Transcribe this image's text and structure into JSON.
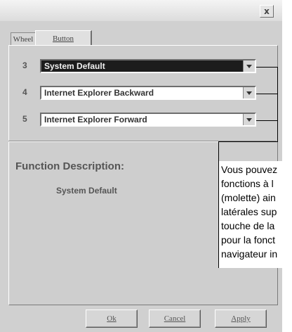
{
  "window": {
    "close_label": "x"
  },
  "tabs": [
    {
      "label": "Wheel"
    },
    {
      "label": "Button"
    }
  ],
  "rows": [
    {
      "number": "3",
      "value": "System Default",
      "selected": true
    },
    {
      "number": "4",
      "value": "Internet Explorer Backward",
      "selected": false
    },
    {
      "number": "5",
      "value": "Internet Explorer Forward",
      "selected": false
    }
  ],
  "function_description": {
    "title": "Function Description:",
    "value": "System Default"
  },
  "buttons": {
    "ok": "Ok",
    "cancel": "Cancel",
    "apply": "Apply"
  },
  "callout": {
    "lines": [
      "Vous pouvez",
      "fonctions à l",
      "(molette) ain",
      "latérales sup",
      "touche de la",
      "pour la fonct",
      "navigateur in"
    ]
  },
  "colors": {
    "dialog_bg": "#d0d0d0",
    "selected_bg": "#1c1c1c",
    "callout_bg": "#ffffff"
  }
}
